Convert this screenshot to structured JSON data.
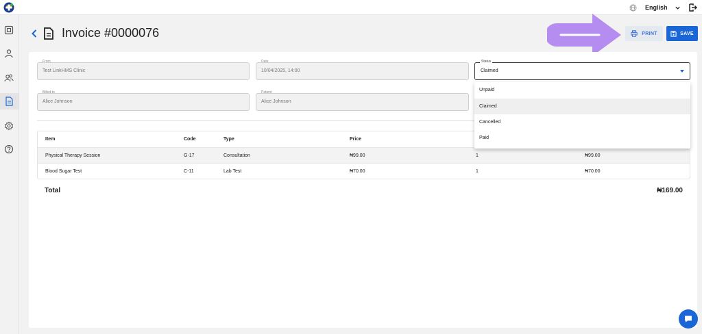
{
  "topbar": {
    "language": "English"
  },
  "header": {
    "title": "Invoice #0000076",
    "print_label": "PRINT",
    "save_label": "SAVE"
  },
  "form": {
    "from": {
      "label": "From",
      "value": "Test LinkHMS Clinic"
    },
    "date": {
      "label": "Date",
      "value": "10/04/2025, 14:00"
    },
    "status": {
      "label": "Status",
      "value": "Claimed",
      "options": [
        "Unpaid",
        "Claimed",
        "Cancelled",
        "Paid"
      ]
    },
    "billed_to": {
      "label": "Billed to",
      "value": "Alice Johnson"
    },
    "patient": {
      "label": "Patient",
      "value": "Alice Johnson"
    }
  },
  "table": {
    "headers": [
      "Item",
      "Code",
      "Type",
      "Price"
    ],
    "rows": [
      {
        "item": "Physical Therapy Session",
        "code": "G-17",
        "type": "Consultation",
        "price": "₦99.00",
        "qty": "1",
        "amount": "₦99.00"
      },
      {
        "item": "Blood Sugar Test",
        "code": "C-11",
        "type": "Lab Test",
        "price": "₦70.00",
        "qty": "1",
        "amount": "₦70.00"
      }
    ]
  },
  "total": {
    "label": "Total",
    "value": "₦169.00"
  },
  "colors": {
    "accent": "#1a66d6",
    "arrow": "#b58cf0",
    "print_bg": "#e4e8ef"
  },
  "icons": [
    "logo-icon",
    "globe-icon",
    "chevron-down-icon",
    "logout-icon",
    "dashboard-icon",
    "user-icon",
    "users-icon",
    "invoice-icon",
    "gear-icon",
    "help-icon",
    "back-icon",
    "printer-icon",
    "floppy-icon",
    "chat-icon",
    "arrow-annotation"
  ]
}
